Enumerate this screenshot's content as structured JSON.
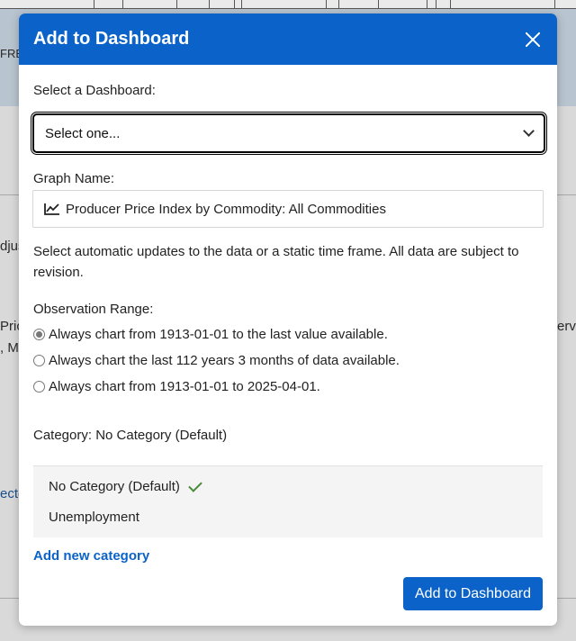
{
  "background": {
    "fragments": [
      "FRE",
      "djus",
      "Pric",
      ", M",
      "erve",
      "ecto"
    ]
  },
  "modal": {
    "title": "Add to Dashboard",
    "dashboard_label": "Select a Dashboard:",
    "dashboard_selected": "Select one...",
    "graph_name_label": "Graph Name:",
    "graph_name_value": "Producer Price Index by Commodity: All Commodities",
    "description": "Select automatic updates to the data or a static time frame. All data are subject to revision.",
    "observation_range_label": "Observation Range:",
    "range_options": [
      {
        "label": "Always chart from 1913-01-01 to the last value available.",
        "checked": true
      },
      {
        "label": "Always chart the last 112 years 3 months of data available.",
        "checked": false
      },
      {
        "label": "Always chart from 1913-01-01 to 2025-04-01.",
        "checked": false
      }
    ],
    "category_label": "Category: No Category (Default)",
    "categories": [
      {
        "label": "No Category (Default)",
        "selected": true
      },
      {
        "label": "Unemployment",
        "selected": false
      }
    ],
    "add_category_link": "Add new category",
    "submit_label": "Add to Dashboard"
  },
  "colors": {
    "header_blue": "#0b63c9",
    "check_green": "#4a8a3a"
  }
}
